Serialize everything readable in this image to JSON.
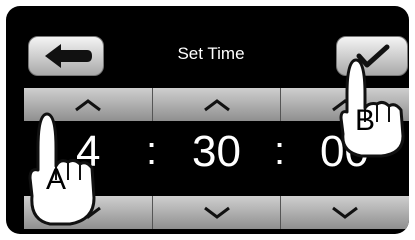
{
  "window": {
    "title": "Set Time"
  },
  "buttons": {
    "back_icon": "back-arrow-icon",
    "confirm_icon": "checkmark-icon"
  },
  "time": {
    "hours": "4",
    "minutes": "30",
    "seconds": "00",
    "separator": ":"
  },
  "annotations": {
    "a": "A",
    "b": "B"
  },
  "colors": {
    "background": "#000000",
    "button_light": "#f4f4f4",
    "button_dark": "#8f8f8f",
    "text": "#ffffff"
  }
}
